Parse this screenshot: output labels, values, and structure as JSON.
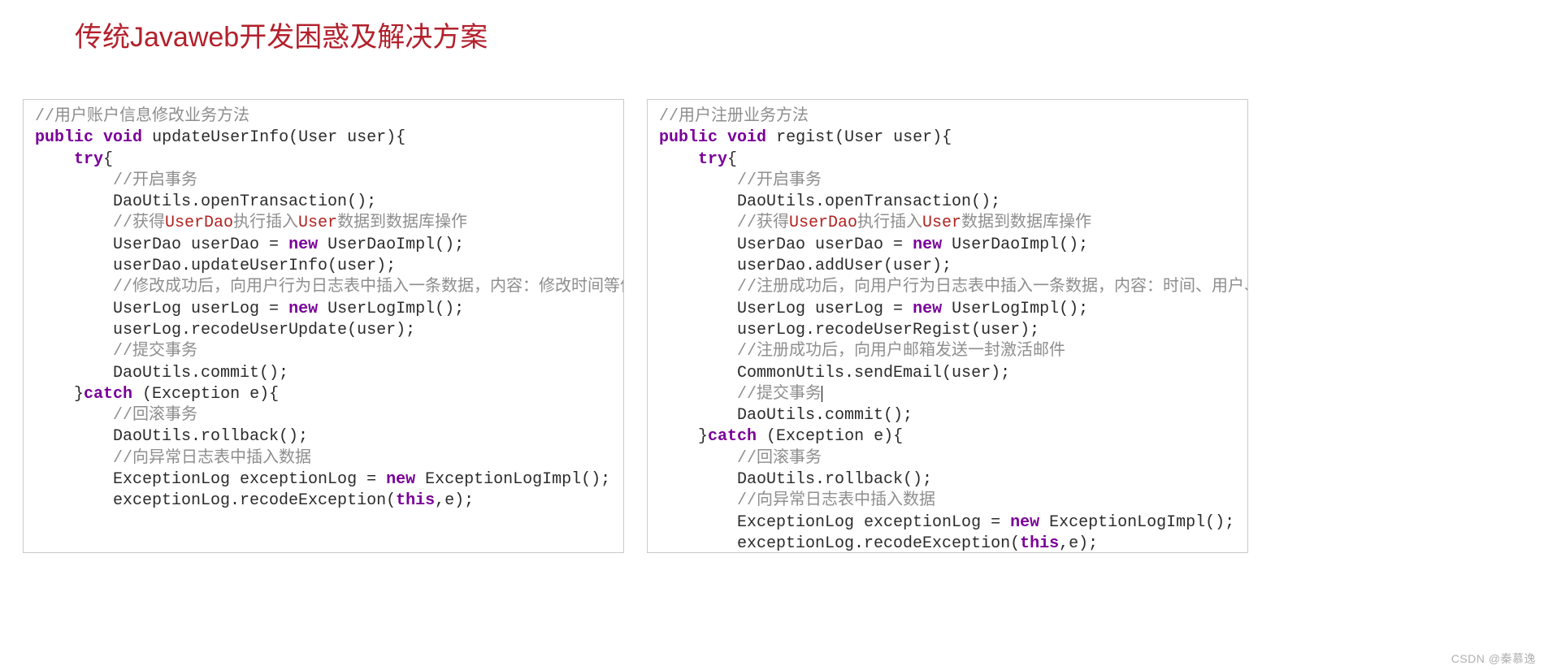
{
  "title": "传统Javaweb开发困惑及解决方案",
  "watermark": "CSDN @秦慕逸",
  "left": {
    "c0": "//用户账户信息修改业务方法",
    "sig_kw1": "public",
    "sig_kw2": "void",
    "sig_name": "updateUserInfo(User user){",
    "try_kw": "try",
    "c1": "//开启事务",
    "l1": "DaoUtils.openTransaction();",
    "c2a": "//获得",
    "c2b": "UserDao",
    "c2c": "执行插入",
    "c2d": "User",
    "c2e": "数据到数据库操作",
    "l2": "UserDao userDao = ",
    "l2_new": "new",
    "l2b": " UserDaoImpl();",
    "l3": "userDao.updateUserInfo(user);",
    "c3": "//修改成功后，向用户行为日志表中插入一条数据，内容：修改时间等信息",
    "l4": "UserLog userLog = ",
    "l4_new": "new",
    "l4b": " UserLogImpl();",
    "l5": "userLog.recodeUserUpdate(user);",
    "c4": "//提交事务",
    "l6": "DaoUtils.commit();",
    "catch_close": "}",
    "catch_kw": "catch",
    "catch_sig": " (Exception e){",
    "c5": "//回滚事务",
    "l7": "DaoUtils.rollback();",
    "c6": "//向异常日志表中插入数据",
    "l8": "ExceptionLog exceptionLog = ",
    "l8_new": "new",
    "l8b": " ExceptionLogImpl();",
    "l9a": "exceptionLog.recodeException(",
    "l9_this": "this",
    "l9b": ",e);"
  },
  "right": {
    "c0": "//用户注册业务方法",
    "sig_kw1": "public",
    "sig_kw2": "void",
    "sig_name": "regist(User user){",
    "try_kw": "try",
    "c1": "//开启事务",
    "l1": "DaoUtils.openTransaction();",
    "c2a": "//获得",
    "c2b": "UserDao",
    "c2c": "执行插入",
    "c2d": "User",
    "c2e": "数据到数据库操作",
    "l2": "UserDao userDao = ",
    "l2_new": "new",
    "l2b": " UserDaoImpl();",
    "l3": "userDao.addUser(user);",
    "c3": "//注册成功后，向用户行为日志表中插入一条数据，内容：时间、用户、注册行为",
    "l4": "UserLog userLog = ",
    "l4_new": "new",
    "l4b": " UserLogImpl();",
    "l5": "userLog.recodeUserRegist(user);",
    "c3b": "//注册成功后，向用户邮箱发送一封激活邮件",
    "l5b": "CommonUtils.sendEmail(user);",
    "c4": "//提交事务",
    "l6": "DaoUtils.commit();",
    "catch_close": "}",
    "catch_kw": "catch",
    "catch_sig": " (Exception e){",
    "c5": "//回滚事务",
    "l7": "DaoUtils.rollback();",
    "c6": "//向异常日志表中插入数据",
    "l8": "ExceptionLog exceptionLog = ",
    "l8_new": "new",
    "l8b": " ExceptionLogImpl();",
    "l9a": "exceptionLog.recodeException(",
    "l9_this": "this",
    "l9b": ",e);"
  }
}
